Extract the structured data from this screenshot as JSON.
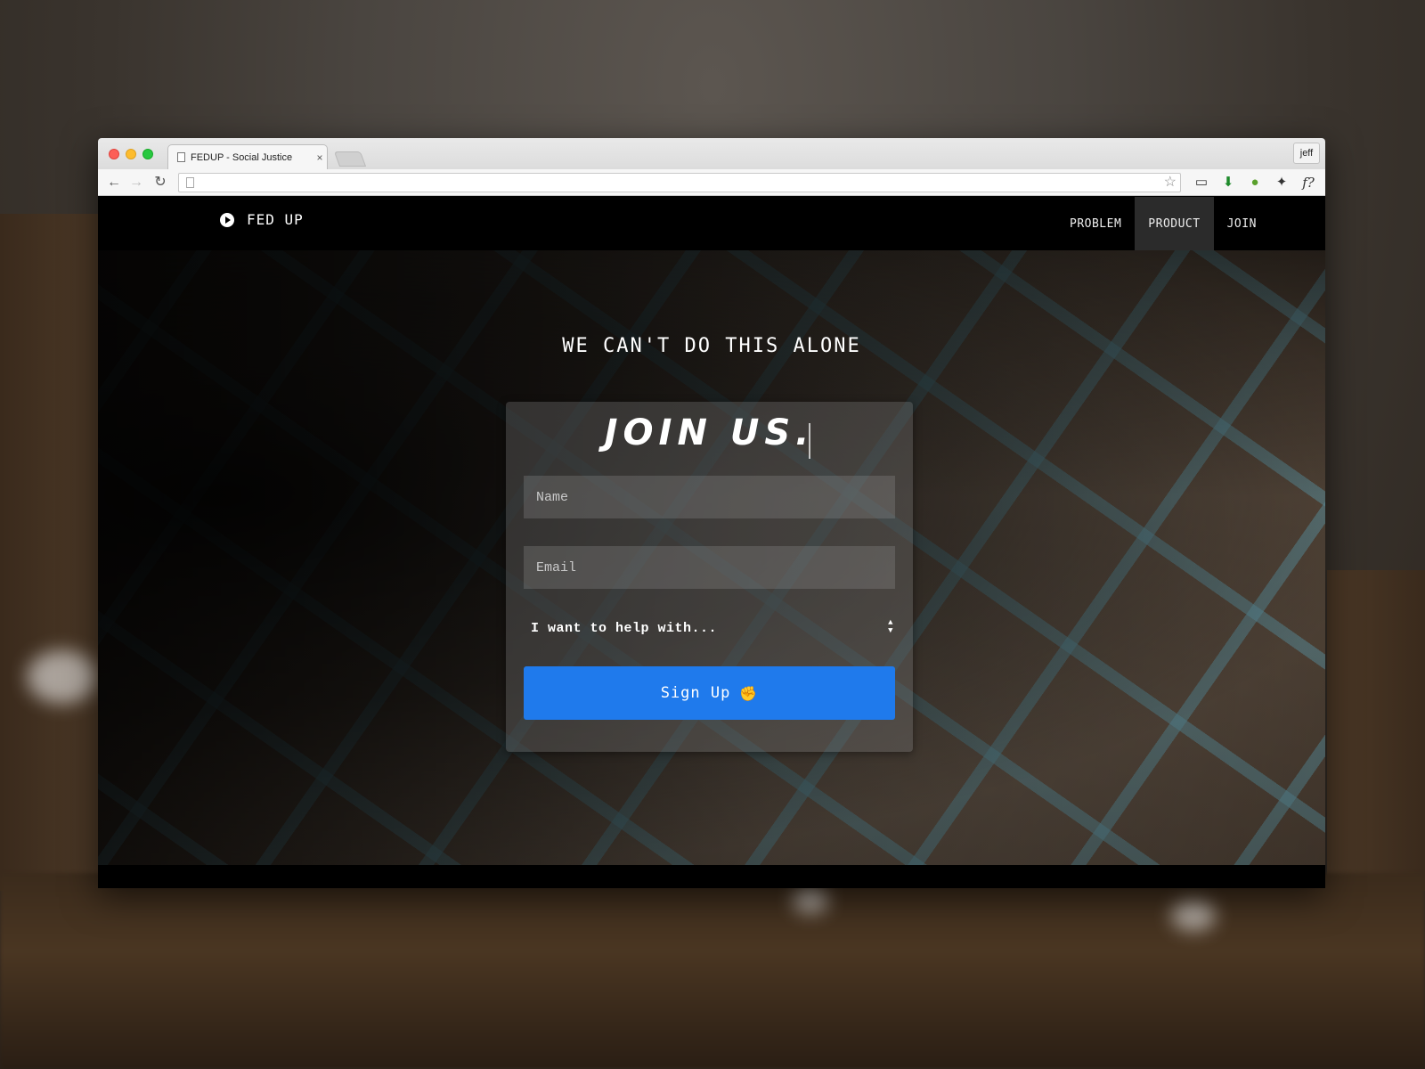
{
  "browser": {
    "tab_title": "FEDUP - Social Justice",
    "tab_close": "×",
    "profile": "jeff",
    "url": ""
  },
  "navbar": {
    "brand": "FED UP",
    "links": [
      "PROBLEM",
      "PRODUCT",
      "JOIN"
    ],
    "active_link": "PRODUCT"
  },
  "hero": {
    "headline": "WE CAN'T DO THIS ALONE"
  },
  "form": {
    "title": "JOIN US.",
    "name_placeholder": "Name",
    "email_placeholder": "Email",
    "select_value": "I want to help with...",
    "submit_label": "Sign Up"
  },
  "colors": {
    "accent": "#1f7aec",
    "navbar_bg": "#000000",
    "active_nav_bg": "#2b2b2b"
  },
  "icons": {
    "brand": "play-circle-icon",
    "submit": "raised-fist-icon",
    "extensions": [
      "cast-icon",
      "download-icon",
      "evernote-icon",
      "bird-icon",
      "font-icon",
      "eyedropper-icon",
      "eye-icon",
      "menu-icon"
    ]
  }
}
